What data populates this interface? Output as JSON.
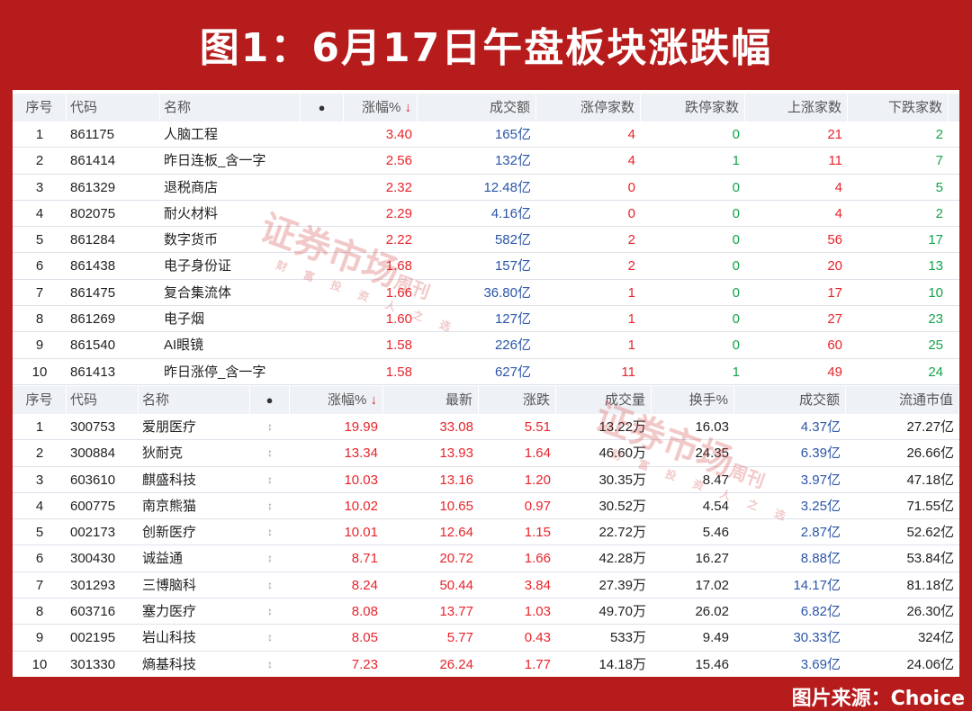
{
  "title": "图1：6月17日午盘板块涨跌幅",
  "source": "图片来源：Choice",
  "watermark": {
    "main": "证券市场",
    "side": "周刊",
    "sub": "财 富 投 资 人 之 选"
  },
  "sector_table": {
    "headers": [
      "序号",
      "代码",
      "名称",
      "●",
      "涨幅%",
      "成交额",
      "涨停家数",
      "跌停家数",
      "上涨家数",
      "下跌家数"
    ],
    "sort_arrow": "↓",
    "rows": [
      [
        "1",
        "861175",
        "人脑工程",
        "3.40",
        "165亿",
        "4",
        "0",
        "21",
        "2"
      ],
      [
        "2",
        "861414",
        "昨日连板_含一字",
        "2.56",
        "132亿",
        "4",
        "1",
        "11",
        "7"
      ],
      [
        "3",
        "861329",
        "退税商店",
        "2.32",
        "12.48亿",
        "0",
        "0",
        "4",
        "5"
      ],
      [
        "4",
        "802075",
        "耐火材料",
        "2.29",
        "4.16亿",
        "0",
        "0",
        "4",
        "2"
      ],
      [
        "5",
        "861284",
        "数字货币",
        "2.22",
        "582亿",
        "2",
        "0",
        "56",
        "17"
      ],
      [
        "6",
        "861438",
        "电子身份证",
        "1.68",
        "157亿",
        "2",
        "0",
        "20",
        "13"
      ],
      [
        "7",
        "861475",
        "复合集流体",
        "1.66",
        "36.80亿",
        "1",
        "0",
        "17",
        "10"
      ],
      [
        "8",
        "861269",
        "电子烟",
        "1.60",
        "127亿",
        "1",
        "0",
        "27",
        "23"
      ],
      [
        "9",
        "861540",
        "AI眼镜",
        "1.58",
        "226亿",
        "1",
        "0",
        "60",
        "25"
      ],
      [
        "10",
        "861413",
        "昨日涨停_含一字",
        "1.58",
        "627亿",
        "11",
        "1",
        "49",
        "24"
      ]
    ]
  },
  "stock_table": {
    "headers": [
      "序号",
      "代码",
      "名称",
      "●",
      "涨幅%",
      "最新",
      "涨跌",
      "成交量",
      "换手%",
      "成交额",
      "流通市值"
    ],
    "sort_arrow": "↓",
    "row_icon": "↕",
    "rows": [
      [
        "1",
        "300753",
        "爱朋医疗",
        "19.99",
        "33.08",
        "5.51",
        "13.22万",
        "16.03",
        "4.37亿",
        "27.27亿"
      ],
      [
        "2",
        "300884",
        "狄耐克",
        "13.34",
        "13.93",
        "1.64",
        "46.60万",
        "24.35",
        "6.39亿",
        "26.66亿"
      ],
      [
        "3",
        "603610",
        "麒盛科技",
        "10.03",
        "13.16",
        "1.20",
        "30.35万",
        "8.47",
        "3.97亿",
        "47.18亿"
      ],
      [
        "4",
        "600775",
        "南京熊猫",
        "10.02",
        "10.65",
        "0.97",
        "30.52万",
        "4.54",
        "3.25亿",
        "71.55亿"
      ],
      [
        "5",
        "002173",
        "创新医疗",
        "10.01",
        "12.64",
        "1.15",
        "22.72万",
        "5.46",
        "2.87亿",
        "52.62亿"
      ],
      [
        "6",
        "300430",
        "诚益通",
        "8.71",
        "20.72",
        "1.66",
        "42.28万",
        "16.27",
        "8.88亿",
        "53.84亿"
      ],
      [
        "7",
        "301293",
        "三博脑科",
        "8.24",
        "50.44",
        "3.84",
        "27.39万",
        "17.02",
        "14.17亿",
        "81.18亿"
      ],
      [
        "8",
        "603716",
        "塞力医疗",
        "8.08",
        "13.77",
        "1.03",
        "49.70万",
        "26.02",
        "6.82亿",
        "26.30亿"
      ],
      [
        "9",
        "002195",
        "岩山科技",
        "8.05",
        "5.77",
        "0.43",
        "533万",
        "9.49",
        "30.33亿",
        "324亿"
      ],
      [
        "10",
        "301330",
        "熵基科技",
        "7.23",
        "26.24",
        "1.77",
        "14.18万",
        "15.46",
        "3.69亿",
        "24.06亿"
      ]
    ]
  },
  "colors": {
    "up": "#e8242b",
    "flat": "#14a34a",
    "amount": "#2a55a8",
    "frame": "#b71c1c"
  }
}
